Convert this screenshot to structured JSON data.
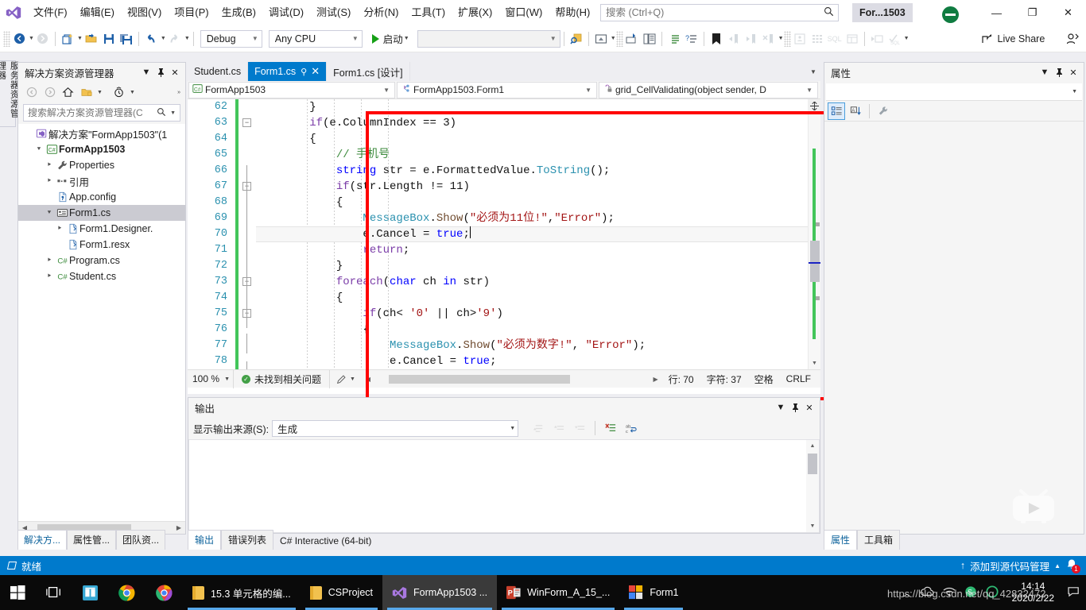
{
  "window": {
    "session_button": "For...1503",
    "minimize": "—",
    "maximize": "❐",
    "close": "✕"
  },
  "menu": {
    "items": [
      {
        "label": "文件(F)"
      },
      {
        "label": "编辑(E)"
      },
      {
        "label": "视图(V)"
      },
      {
        "label": "项目(P)"
      },
      {
        "label": "生成(B)"
      },
      {
        "label": "调试(D)"
      },
      {
        "label": "测试(S)"
      },
      {
        "label": "分析(N)"
      },
      {
        "label": "工具(T)"
      },
      {
        "label": "扩展(X)"
      },
      {
        "label": "窗口(W)"
      },
      {
        "label": "帮助(H)"
      }
    ]
  },
  "quick_search": {
    "placeholder": "搜索 (Ctrl+Q)",
    "value": ""
  },
  "toolbar": {
    "configuration": "Debug",
    "platform": "Any CPU",
    "start_label": "启动",
    "target_value": "",
    "live_share": "Live Share"
  },
  "vertical_tab": {
    "label": "服务器资源管理器"
  },
  "solution_explorer": {
    "title": "解决方案资源管理器",
    "search_placeholder": "搜索解决方案资源管理器(C",
    "tree": [
      {
        "depth": 0,
        "arrow": "",
        "icon": "solution-icon",
        "label": "解决方案\"FormApp1503\"(1",
        "bold": false,
        "selected": false
      },
      {
        "depth": 1,
        "arrow": "▲",
        "icon": "csharp-project-icon",
        "label": "FormApp1503",
        "bold": true,
        "selected": false
      },
      {
        "depth": 2,
        "arrow": "▶",
        "icon": "wrench-icon",
        "label": "Properties",
        "bold": false,
        "selected": false
      },
      {
        "depth": 2,
        "arrow": "▶",
        "icon": "references-icon",
        "label": "引用",
        "bold": false,
        "selected": false
      },
      {
        "depth": 2,
        "arrow": "",
        "icon": "config-file-icon",
        "label": "App.config",
        "bold": false,
        "selected": false
      },
      {
        "depth": 2,
        "arrow": "▲",
        "icon": "form-icon",
        "label": "Form1.cs",
        "bold": false,
        "selected": true
      },
      {
        "depth": 3,
        "arrow": "▶",
        "icon": "code-file-icon",
        "label": "Form1.Designer.",
        "bold": false,
        "selected": false
      },
      {
        "depth": 3,
        "arrow": "",
        "icon": "resx-file-icon",
        "label": "Form1.resx",
        "bold": false,
        "selected": false
      },
      {
        "depth": 2,
        "arrow": "▶",
        "icon": "csharp-file-icon",
        "label": "Program.cs",
        "bold": false,
        "selected": false
      },
      {
        "depth": 2,
        "arrow": "▶",
        "icon": "csharp-file-icon",
        "label": "Student.cs",
        "bold": false,
        "selected": false
      }
    ],
    "dock_tabs": [
      {
        "label": "解决方...",
        "active": true
      },
      {
        "label": "属性管...",
        "active": false
      },
      {
        "label": "团队资...",
        "active": false
      }
    ]
  },
  "editor": {
    "document_tabs": [
      {
        "label": "Student.cs",
        "active": false,
        "closable": false
      },
      {
        "label": "Form1.cs",
        "active": true,
        "closable": true
      },
      {
        "label": "Form1.cs [设计]",
        "active": false,
        "closable": false
      }
    ],
    "nav_project": "FormApp1503",
    "nav_type": "FormApp1503.Form1",
    "nav_member": "grid_CellValidating(object sender, D",
    "first_line_number": 62,
    "lines": [
      {
        "n": 62,
        "tokens": [
          {
            "t": "        }",
            "c": "pl"
          }
        ]
      },
      {
        "n": 63,
        "fold": "collapse",
        "tokens": [
          {
            "t": "        ",
            "c": "pl"
          },
          {
            "t": "if",
            "c": "kp"
          },
          {
            "t": "(e.ColumnIndex == ",
            "c": "pl"
          },
          {
            "t": "3",
            "c": "pl"
          },
          {
            "t": ")",
            "c": "pl"
          }
        ]
      },
      {
        "n": 64,
        "tokens": [
          {
            "t": "        {",
            "c": "pl"
          }
        ]
      },
      {
        "n": 65,
        "tokens": [
          {
            "t": "            ",
            "c": "pl"
          },
          {
            "t": "// 手机号",
            "c": "cm"
          }
        ]
      },
      {
        "n": 66,
        "tokens": [
          {
            "t": "            ",
            "c": "pl"
          },
          {
            "t": "string",
            "c": "k"
          },
          {
            "t": " str = e.FormattedValue.",
            "c": "pl"
          },
          {
            "t": "ToString",
            "c": "ty"
          },
          {
            "t": "();",
            "c": "pl"
          }
        ]
      },
      {
        "n": 67,
        "fold": "collapse",
        "tokens": [
          {
            "t": "            ",
            "c": "pl"
          },
          {
            "t": "if",
            "c": "kp"
          },
          {
            "t": "(str.Length != ",
            "c": "pl"
          },
          {
            "t": "11",
            "c": "pl"
          },
          {
            "t": ")",
            "c": "pl"
          }
        ]
      },
      {
        "n": 68,
        "tokens": [
          {
            "t": "            {",
            "c": "pl"
          }
        ]
      },
      {
        "n": 69,
        "tokens": [
          {
            "t": "                ",
            "c": "pl"
          },
          {
            "t": "MessageBox",
            "c": "ty"
          },
          {
            "t": ".",
            "c": "pl"
          },
          {
            "t": "Show",
            "c": "mh"
          },
          {
            "t": "(",
            "c": "pl"
          },
          {
            "t": "\"必须为11位!\"",
            "c": "st"
          },
          {
            "t": ",",
            "c": "pl"
          },
          {
            "t": "\"Error\"",
            "c": "st"
          },
          {
            "t": ");",
            "c": "pl"
          }
        ]
      },
      {
        "n": 70,
        "current": true,
        "tokens": [
          {
            "t": "                e.Cancel = ",
            "c": "pl"
          },
          {
            "t": "true",
            "c": "k"
          },
          {
            "t": ";",
            "c": "pl"
          }
        ]
      },
      {
        "n": 71,
        "tokens": [
          {
            "t": "                ",
            "c": "pl"
          },
          {
            "t": "return",
            "c": "kp"
          },
          {
            "t": ";",
            "c": "pl"
          }
        ]
      },
      {
        "n": 72,
        "tokens": [
          {
            "t": "            }",
            "c": "pl"
          }
        ]
      },
      {
        "n": 73,
        "fold": "collapse",
        "tokens": [
          {
            "t": "            ",
            "c": "pl"
          },
          {
            "t": "foreach",
            "c": "kp"
          },
          {
            "t": "(",
            "c": "pl"
          },
          {
            "t": "char",
            "c": "k"
          },
          {
            "t": " ch ",
            "c": "pl"
          },
          {
            "t": "in",
            "c": "k"
          },
          {
            "t": " str)",
            "c": "pl"
          }
        ]
      },
      {
        "n": 74,
        "tokens": [
          {
            "t": "            {",
            "c": "pl"
          }
        ]
      },
      {
        "n": 75,
        "fold": "collapse",
        "tokens": [
          {
            "t": "                ",
            "c": "pl"
          },
          {
            "t": "if",
            "c": "kp"
          },
          {
            "t": "(ch< ",
            "c": "pl"
          },
          {
            "t": "'0'",
            "c": "st"
          },
          {
            "t": " || ch>",
            "c": "pl"
          },
          {
            "t": "'9'",
            "c": "st"
          },
          {
            "t": ")",
            "c": "pl"
          }
        ]
      },
      {
        "n": 76,
        "tokens": [
          {
            "t": "                {",
            "c": "pl"
          }
        ]
      },
      {
        "n": 77,
        "tokens": [
          {
            "t": "                    ",
            "c": "pl"
          },
          {
            "t": "MessageBox",
            "c": "ty"
          },
          {
            "t": ".",
            "c": "pl"
          },
          {
            "t": "Show",
            "c": "mh"
          },
          {
            "t": "(",
            "c": "pl"
          },
          {
            "t": "\"必须为数字!\"",
            "c": "st"
          },
          {
            "t": ", ",
            "c": "pl"
          },
          {
            "t": "\"Error\"",
            "c": "st"
          },
          {
            "t": ");",
            "c": "pl"
          }
        ]
      },
      {
        "n": 78,
        "tokens": [
          {
            "t": "                    e.Cancel = ",
            "c": "pl"
          },
          {
            "t": "true",
            "c": "k"
          },
          {
            "t": ";",
            "c": "pl"
          }
        ]
      }
    ],
    "status": {
      "zoom": "100 %",
      "issues": "未找到相关问题",
      "line": "行: 70",
      "column": "字符: 37",
      "spaces": "空格",
      "eol": "CRLF"
    }
  },
  "output_panel": {
    "title": "输出",
    "source_label": "显示输出来源(S):",
    "source_value": "生成",
    "body_text": ""
  },
  "bottom_tabs": [
    {
      "label": "输出",
      "active": true
    },
    {
      "label": "错误列表",
      "active": false
    },
    {
      "label": "C# Interactive (64-bit)",
      "active": false
    }
  ],
  "properties_panel": {
    "title": "属性",
    "selected_object": "",
    "dock_tabs": [
      {
        "label": "属性",
        "active": true
      },
      {
        "label": "工具箱",
        "active": false
      }
    ]
  },
  "status_bar": {
    "ready": "就绪",
    "source_control": "添加到源代码管理",
    "notification_count": "1"
  },
  "taskbar": {
    "items": [
      {
        "label": "",
        "icon": "windows-start-icon",
        "type": "start"
      },
      {
        "label": "",
        "icon": "task-view-icon",
        "type": "pinned"
      },
      {
        "label": "",
        "icon": "store-icon",
        "type": "pinned"
      },
      {
        "label": "",
        "icon": "chrome-icon",
        "type": "pinned"
      },
      {
        "label": "",
        "icon": "chrome-canary-icon",
        "type": "pinned"
      },
      {
        "label": "15.3 单元格的编...",
        "icon": "folder-icon",
        "type": "running"
      },
      {
        "label": "CSProject",
        "icon": "folder-icon",
        "type": "running"
      },
      {
        "label": "FormApp1503 ...",
        "icon": "visual-studio-icon",
        "type": "active"
      },
      {
        "label": "WinForm_A_15_...",
        "icon": "powerpoint-icon",
        "type": "running"
      },
      {
        "label": "Form1",
        "icon": "winform-app-icon",
        "type": "running"
      }
    ],
    "clock_time": "14:14",
    "clock_date": "2020/2/22"
  },
  "watermark": {
    "url": "https://blog.csdn.net/qq_42832472"
  },
  "colors": {
    "accent": "#007acc",
    "tab_active": "#007acc",
    "changebar": "#43c55a",
    "highlight_rect": "#ff0000",
    "taskbar": "#0a0a0a"
  }
}
